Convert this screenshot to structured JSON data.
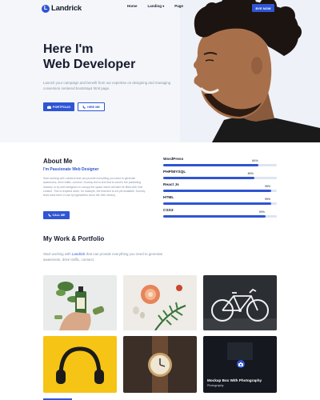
{
  "brand": {
    "name": "Landrick",
    "mark": "L",
    "color": "#2f55d4"
  },
  "nav": {
    "items": [
      {
        "label": "Home"
      },
      {
        "label": "Landing",
        "caret": "▾"
      },
      {
        "label": "Page"
      }
    ],
    "buy_label": "BYE NOW"
  },
  "hero": {
    "title_line1": "Here I'm",
    "title_line2": "Web Developer",
    "subtitle": "Launch your campaign and benefit from our expertise on designing and managing conversion centered bootstrap4 html page.",
    "portfolio_button": "PORTFOLIO",
    "hire_button": "HIRE ME",
    "portfolio_icon": "briefcase-icon",
    "hire_icon": "phone-icon"
  },
  "about": {
    "title": "About Me",
    "subtitle": "I'm Passionate Web Designer",
    "text": "Start working with Landrick that can provide everything you need to generate awareness, drive traffic, connect. Dummy text is text that is used in the publishing industry or by web designers to occupy the space which will later be filled with 'real' content. This is required when, for example, the final text is not yet available. Dummy texts have been in use by typesetters since the 16th century.",
    "call_button": "CALL ME",
    "call_icon": "phone-icon"
  },
  "skills": [
    {
      "name": "WordPress",
      "percent": 84,
      "label": "84%"
    },
    {
      "name": "PHP/MYSQL",
      "percent": 80,
      "label": "80%"
    },
    {
      "name": "React Js",
      "percent": 95,
      "label": "95%"
    },
    {
      "name": "HTML",
      "percent": 95,
      "label": "95%"
    },
    {
      "name": "CSS3",
      "percent": 90,
      "label": "90%"
    }
  ],
  "portfolio": {
    "title": "My Work & Portfolio",
    "text_before": "Start working with ",
    "text_highlight": "Landrick",
    "text_after": " that can provide everything you need to generate awareness, drive traffic, connect.",
    "hover_caption_title": "Mockup Box With Photography",
    "hover_caption_sub": "Photography",
    "hover_icon": "camera-icon"
  }
}
